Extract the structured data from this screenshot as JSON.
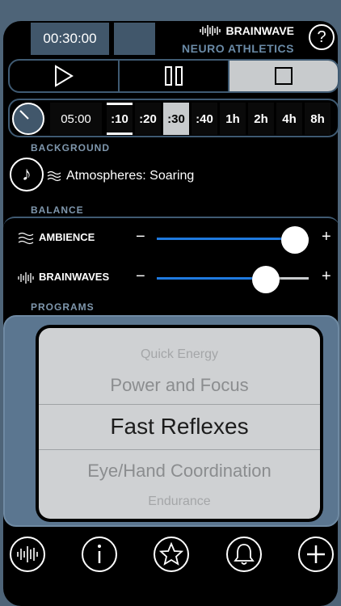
{
  "header": {
    "timer": "00:30:00",
    "brand_line1": "BRAINWAVE",
    "brand_line2": "NEURO ATHLETICS",
    "help_label": "?"
  },
  "duration": {
    "set_time": "05:00",
    "options": [
      ":10",
      ":20",
      ":30",
      ":40",
      "1h",
      "2h",
      "4h",
      "8h"
    ],
    "selected": ":30",
    "active": ":10"
  },
  "sections": {
    "background": "BACKGROUND",
    "balance": "BALANCE",
    "programs": "PROGRAMS"
  },
  "background": {
    "label": "Atmospheres: Soaring"
  },
  "balance": {
    "ambience": {
      "label": "AMBIENCE",
      "minus": "−",
      "plus": "+",
      "level": 0.91
    },
    "brainwaves": {
      "label": "BRAINWAVES",
      "minus": "−",
      "plus": "+",
      "level": 0.72
    }
  },
  "programs": {
    "items": [
      "Quick Energy",
      "Power and Focus",
      "Fast Reflexes",
      "Eye/Hand Coordination",
      "Endurance"
    ],
    "selected": "Fast Reflexes"
  },
  "colors": {
    "accent": "#1f7ae0",
    "panel": "#41576b",
    "frame": "#4e6478"
  }
}
